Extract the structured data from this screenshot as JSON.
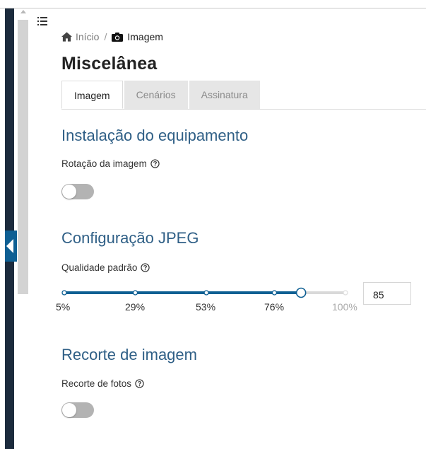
{
  "breadcrumb": {
    "home": "Início",
    "separator": "/",
    "current": "Imagem"
  },
  "page_title": "Miscelânea",
  "tabs": [
    {
      "label": "Imagem",
      "active": true
    },
    {
      "label": "Cenários",
      "active": false
    },
    {
      "label": "Assinatura",
      "active": false
    }
  ],
  "sections": {
    "install": {
      "title": "Instalação do equipamento",
      "field_label": "Rotação da imagem",
      "toggle_on": false
    },
    "jpeg": {
      "title": "Configuração JPEG",
      "field_label": "Qualidade padrão",
      "slider": {
        "ticks": [
          "5%",
          "29%",
          "53%",
          "76%",
          "100%"
        ],
        "value": 85,
        "min": 5,
        "max": 100
      }
    },
    "crop": {
      "title": "Recorte de imagem",
      "field_label": "Recorte de fotos",
      "toggle_on": false
    }
  },
  "colors": {
    "accent": "#0e5f93",
    "section_title": "#2f5f86",
    "rail": "#1c2b3d",
    "toggle_off": "#b3b3b3"
  },
  "icons": [
    "menu-icon",
    "home-icon",
    "camera-icon",
    "help-icon",
    "collapse-arrow-icon"
  ]
}
